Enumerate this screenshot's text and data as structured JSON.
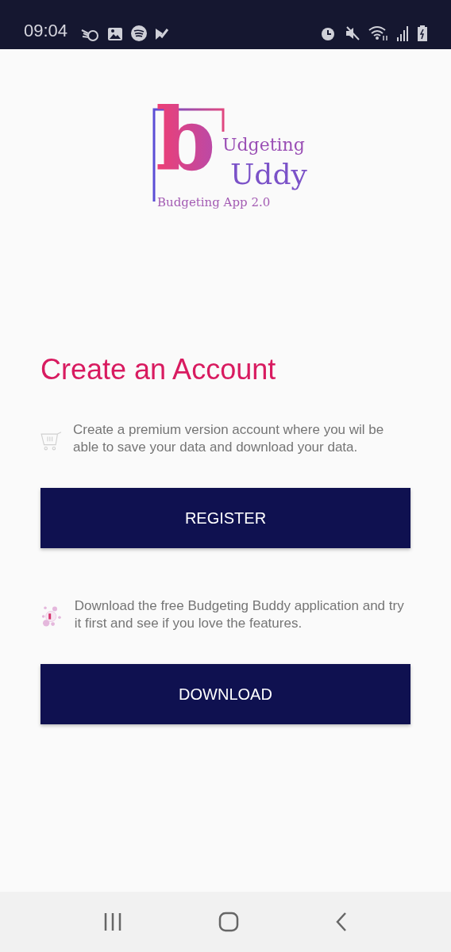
{
  "status_bar": {
    "time": "09:04"
  },
  "logo": {
    "letter": "b",
    "line_1": "Udgeting",
    "line_2": "Uddy",
    "tagline": "Budgeting App 2.0"
  },
  "title": "Create an Account",
  "sections": [
    {
      "kind": "cart",
      "text": "Create a premium version account where you wil be able to save your data and download your data.",
      "button": "REGISTER"
    },
    {
      "kind": "bubbles",
      "text": "Download the free Budgeting Buddy application and try it first and see if you love the features.",
      "button": "DOWNLOAD"
    }
  ]
}
